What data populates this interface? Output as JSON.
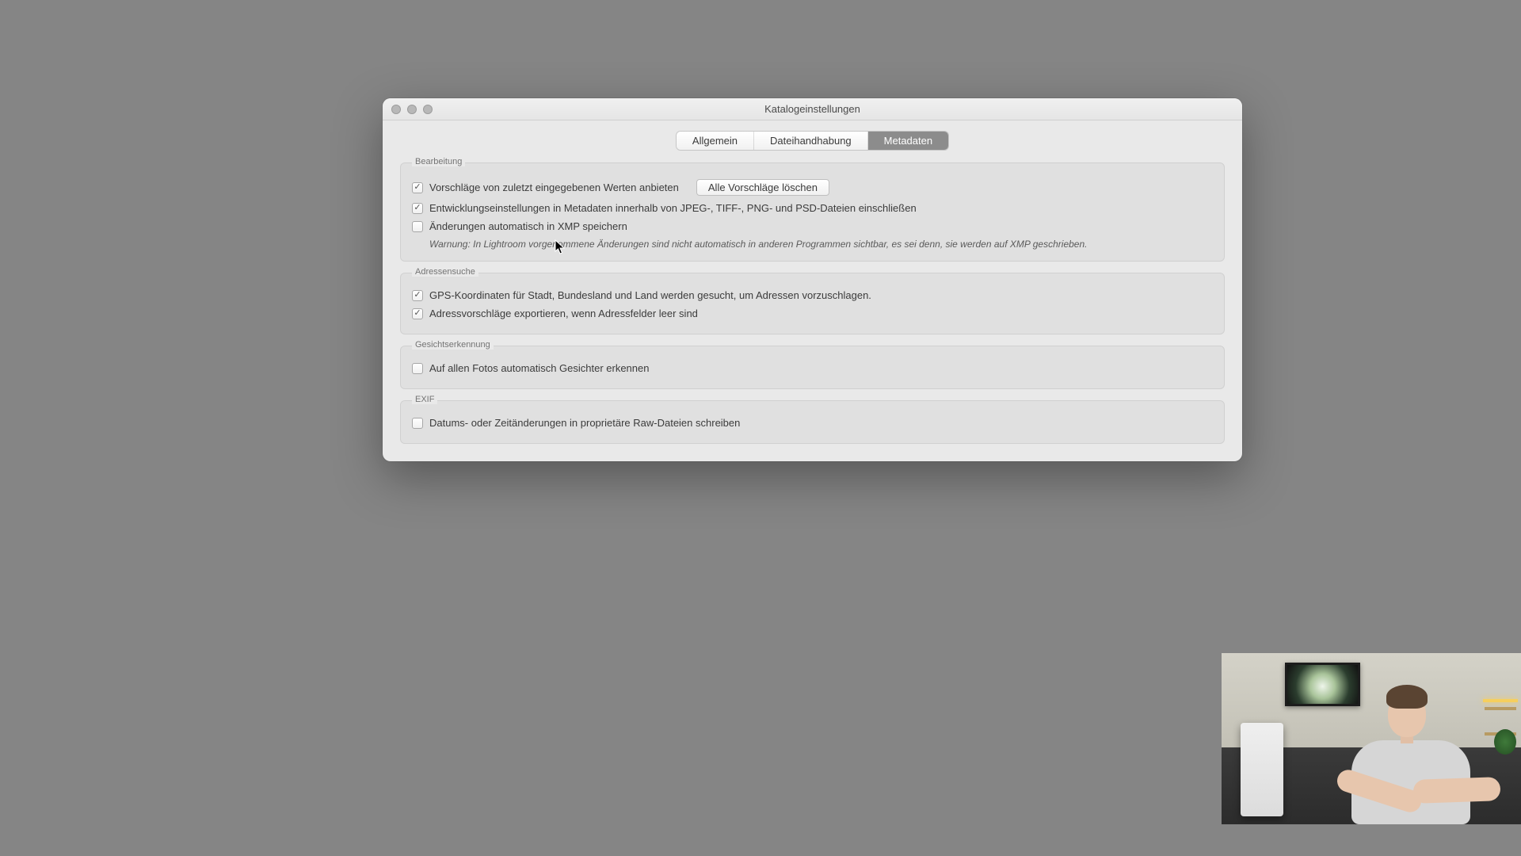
{
  "window": {
    "title": "Katalogeinstellungen"
  },
  "tabs": [
    {
      "label": "Allgemein",
      "active": false
    },
    {
      "label": "Dateihandhabung",
      "active": false
    },
    {
      "label": "Metadaten",
      "active": true
    }
  ],
  "groups": {
    "editing": {
      "label": "Bearbeitung",
      "suggestions": "Vorschläge von zuletzt eingegebenen Werten anbieten",
      "clear_btn": "Alle Vorschläge löschen",
      "dev_settings": "Entwicklungseinstellungen in Metadaten innerhalb von JPEG-, TIFF-, PNG- und PSD-Dateien einschließen",
      "auto_xmp": "Änderungen automatisch in XMP speichern",
      "warning": "Warnung: In Lightroom vorgenommene Änderungen sind nicht automatisch in anderen Programmen sichtbar, es sei denn, sie werden auf XMP geschrieben."
    },
    "address": {
      "label": "Adressensuche",
      "gps": "GPS-Koordinaten für Stadt, Bundesland und Land werden gesucht, um Adressen vorzuschlagen.",
      "export": "Adressvorschläge exportieren, wenn Adressfelder leer sind"
    },
    "face": {
      "label": "Gesichtserkennung",
      "auto_detect": "Auf allen Fotos automatisch Gesichter erkennen"
    },
    "exif": {
      "label": "EXIF",
      "date_raw": "Datums- oder Zeitänderungen in proprietäre Raw-Dateien schreiben"
    }
  }
}
